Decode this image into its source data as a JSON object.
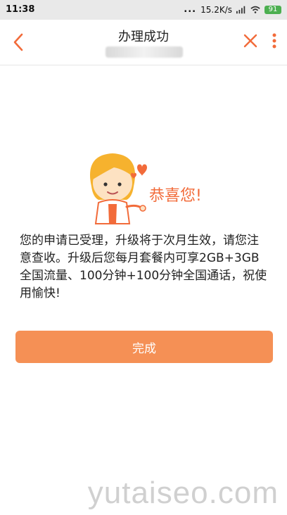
{
  "status_bar": {
    "time": "11:38",
    "dots": "...",
    "speed": "15.2K/s",
    "battery": "91"
  },
  "header": {
    "title": "办理成功",
    "subtitle_masked": true
  },
  "content": {
    "congrats_text": "恭喜您!",
    "message": "您的申请已受理，升级将于次月生效，请您注意查收。升级后您每月套餐内可享2GB+3GB全国流量、100分钟+100分钟全国通话，祝使用愉快!"
  },
  "actions": {
    "done_label": "完成"
  },
  "watermark": {
    "text": "yutaiseo.com"
  },
  "colors": {
    "accent": "#f26b3a",
    "button": "#f59055",
    "status_bar": "#e9e9e9"
  },
  "icons": {
    "back": "back-arrow-icon",
    "close": "close-icon",
    "more": "more-vertical-icon"
  }
}
